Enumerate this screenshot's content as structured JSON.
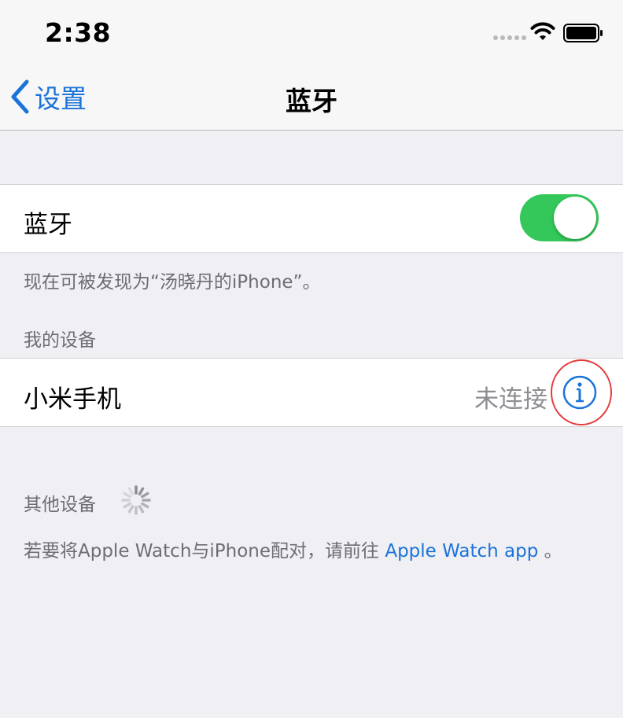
{
  "status_bar": {
    "time": "2:38",
    "signal_icon": "signal-dots-icon",
    "wifi_icon": "wifi-icon",
    "battery_icon": "battery-icon"
  },
  "nav": {
    "back_label": "设置",
    "title": "蓝牙",
    "back_icon": "chevron-left-icon"
  },
  "bluetooth": {
    "label": "蓝牙",
    "toggle_on": true,
    "discoverable_text": "现在可被发现为“汤晓丹的iPhone”。"
  },
  "my_devices": {
    "header": "我的设备",
    "devices": [
      {
        "name": "小米手机",
        "status": "未连接",
        "info_icon": "info-icon"
      }
    ]
  },
  "other_devices": {
    "header": "其他设备",
    "spinner_icon": "loading-spinner-icon",
    "footer_text": "若要将Apple Watch与iPhone配对，请前往",
    "footer_link": "Apple Watch app",
    "footer_end": "。"
  },
  "colors": {
    "accent": "#1a73d9",
    "toggle_on": "#34c759",
    "background": "#efeff4",
    "annotation_circle": "#e33b3b"
  }
}
